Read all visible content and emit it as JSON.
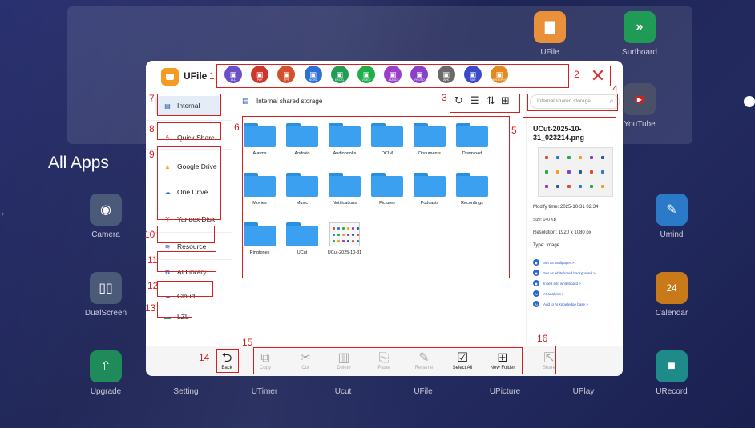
{
  "launcher": {
    "all_apps_label": "All Apps",
    "apps": [
      {
        "label": "UFile",
        "icon": "folder-icon",
        "color": "#e8913a"
      },
      {
        "label": "Surfboard",
        "icon": "chevron-right-icon",
        "color": "#1f9b56"
      },
      {
        "label": "YouTube",
        "icon": "youtube-icon",
        "color": "#cc2222"
      },
      {
        "label": "Camera",
        "icon": "camera-icon",
        "color": "#4a5a78"
      },
      {
        "label": "Umind",
        "icon": "pen-icon",
        "color": "#2a7ac8"
      },
      {
        "label": "DualScreen",
        "icon": "dual-screen-icon",
        "color": "#4a5a78"
      },
      {
        "label": "Calendar",
        "icon": "calendar-icon",
        "color": "#c87a1a"
      },
      {
        "label": "Upgrade",
        "icon": "upgrade-icon",
        "color": "#1f8a5a"
      },
      {
        "label": "Setting",
        "icon": "gear-icon",
        "color": "#4a5a78"
      },
      {
        "label": "UTimer",
        "icon": "timer-icon",
        "color": "#4a5a78"
      },
      {
        "label": "Ucut",
        "icon": "scissors-icon",
        "color": "#4a5a78"
      },
      {
        "label": "UFile",
        "icon": "folder-icon",
        "color": "#4a5a78"
      },
      {
        "label": "UPicture",
        "icon": "picture-icon",
        "color": "#4a5a78"
      },
      {
        "label": "UPlay",
        "icon": "play-icon",
        "color": "#4a5a78"
      },
      {
        "label": "URecord",
        "icon": "record-icon",
        "color": "#1f8a8a"
      }
    ],
    "calendar_day": "24"
  },
  "dialog": {
    "title": "UFile",
    "categories": [
      {
        "label": "ALL",
        "color": "#6a4fc8",
        "icon": "all-icon"
      },
      {
        "label": "PDF",
        "color": "#d0352b",
        "icon": "pdf-icon"
      },
      {
        "label": "PPT",
        "color": "#d2502b",
        "icon": "ppt-icon"
      },
      {
        "label": "WORD",
        "color": "#2e6fd8",
        "icon": "word-icon"
      },
      {
        "label": "EXCEL",
        "color": "#1f9d55",
        "icon": "excel-icon"
      },
      {
        "label": "VIDEO",
        "color": "#1fae4a",
        "icon": "video-icon"
      },
      {
        "label": "AUDIO",
        "color": "#9a3fc8",
        "icon": "audio-icon"
      },
      {
        "label": "PHOTO",
        "color": "#8a3fc8",
        "icon": "photo-icon"
      },
      {
        "label": "APK",
        "color": "#6a6a6a",
        "icon": "apk-icon"
      },
      {
        "label": "RAR",
        "color": "#3a4ac8",
        "icon": "rar-icon"
      },
      {
        "label": "WHITEPNG",
        "color": "#e08a1f",
        "icon": "whiteboard-icon"
      }
    ],
    "sidebar": {
      "internal": "Internal",
      "quick_share": "Quick Share",
      "google_drive": "Google Drive",
      "one_drive": "One Drive",
      "yandex_disk": "Yandex Disk",
      "resource": "Resource",
      "ai_library": "AI Library",
      "cloud": "Cloud",
      "lzl": "LZL"
    },
    "path": "Internal shared storage",
    "search_placeholder": "Internal shared storage",
    "files": [
      {
        "name": "Alarms",
        "type": "folder"
      },
      {
        "name": "Android",
        "type": "folder"
      },
      {
        "name": "Audiobooks",
        "type": "folder"
      },
      {
        "name": "DCIM",
        "type": "folder"
      },
      {
        "name": "Documents",
        "type": "folder"
      },
      {
        "name": "Download",
        "type": "folder"
      },
      {
        "name": "Movies",
        "type": "folder"
      },
      {
        "name": "Music",
        "type": "folder"
      },
      {
        "name": "Notifications",
        "type": "folder"
      },
      {
        "name": "Pictures",
        "type": "folder"
      },
      {
        "name": "Podcasts",
        "type": "folder"
      },
      {
        "name": "Recordings",
        "type": "folder"
      },
      {
        "name": "Ringtones",
        "type": "folder"
      },
      {
        "name": "UCut",
        "type": "folder"
      },
      {
        "name": "UCut-2025-10-31",
        "type": "image"
      }
    ],
    "detail": {
      "filename": "UCut-2025-10-31_023214.png",
      "modify_time": "Modify time: 2025-10-31 02:34",
      "size": "Size: 140 KB",
      "resolution": "Resolution: 1920 x 1080 px",
      "type": "Type: Image",
      "actions": [
        "Set as Wallpaper >",
        "Set as whiteboard background >",
        "Insert into whiteboard >",
        "AI analysis >",
        "Add to AI knowledge base >"
      ]
    },
    "bottom": {
      "back": "Back",
      "copy": "Copy",
      "cut": "Cut",
      "delete": "Delete",
      "paste": "Paste",
      "rename": "Rename",
      "select_all": "Select All",
      "new_folder": "New Folder",
      "share": "Share"
    }
  },
  "annotations": [
    "1",
    "2",
    "3",
    "4",
    "5",
    "6",
    "7",
    "8",
    "9",
    "10",
    "11",
    "12",
    "13",
    "14",
    "15",
    "16"
  ],
  "colors": {
    "annotation": "#d62020",
    "accent": "#2a55a8",
    "folder": "#3aa0ef"
  }
}
